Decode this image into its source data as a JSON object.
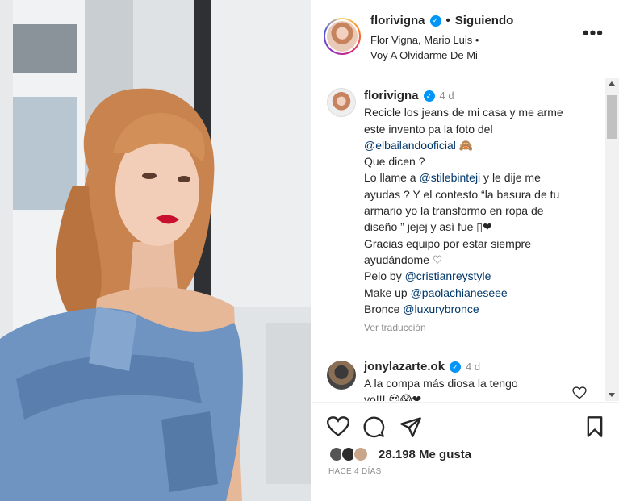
{
  "post": {
    "username": "florivigna",
    "follow_state": "Siguiendo",
    "separator": "•",
    "audio_line1": "Flor Vigna, Mario Luis •",
    "audio_line2": "Voy A Olvidarme De Mi",
    "more_label": "•••"
  },
  "caption": {
    "username": "florivigna",
    "time": "4 d",
    "line1": "Recicle los jeans de mi casa y me arme",
    "line2": "este invento pa la foto del",
    "mention1": "@elbailandooficial",
    "emoji1": "🙈",
    "line3": "Que dicen ?",
    "line4a": "Lo llame a ",
    "mention2": "@stilebinteji",
    "line4b": " y le dije me",
    "line5": "ayudas ? Y el contesto “la basura de tu",
    "line6": "armario yo la transformo en ropa de",
    "line7": "diseño ” jejej y así fue ▯❤",
    "line8": "Gracias equipo por estar siempre",
    "line9": "ayudándome ♡",
    "line10a": "Pelo by ",
    "mention3": "@cristianreystyle",
    "line11a": "Make up ",
    "mention4": "@paolachianeseee",
    "line12a": "Bronce ",
    "mention5": "@luxurybronce",
    "see_translation": "Ver traducción"
  },
  "comment2": {
    "username": "jonylazarte.ok",
    "time": "4 d",
    "line1": "A la compa más diosa la tengo",
    "line2": "yo!!! 😍😱❤"
  },
  "footer": {
    "likes": "28.198 Me gusta",
    "time_ago": "HACE 4 DÍAS"
  },
  "colors": {
    "link": "#00376b",
    "verified": "#0095f6",
    "muted": "#8e8e8e"
  }
}
